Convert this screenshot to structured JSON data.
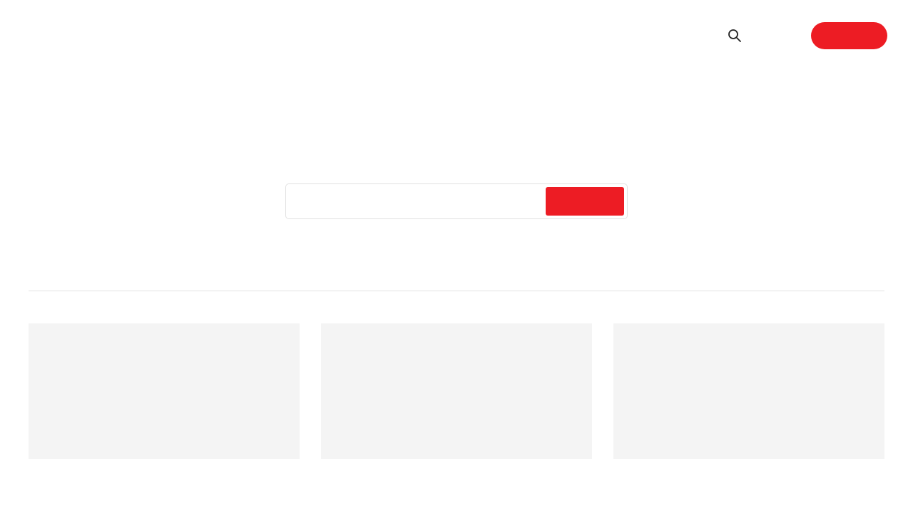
{
  "header": {
    "search_icon": "search-icon",
    "cta_label": ""
  },
  "search": {
    "value": "",
    "placeholder": "",
    "submit_label": ""
  },
  "cards": [
    {
      "title": ""
    },
    {
      "title": ""
    },
    {
      "title": ""
    }
  ],
  "colors": {
    "accent": "#ed1c24",
    "card_bg": "#f4f4f4",
    "border": "#e2e2e2",
    "icon": "#222222"
  }
}
